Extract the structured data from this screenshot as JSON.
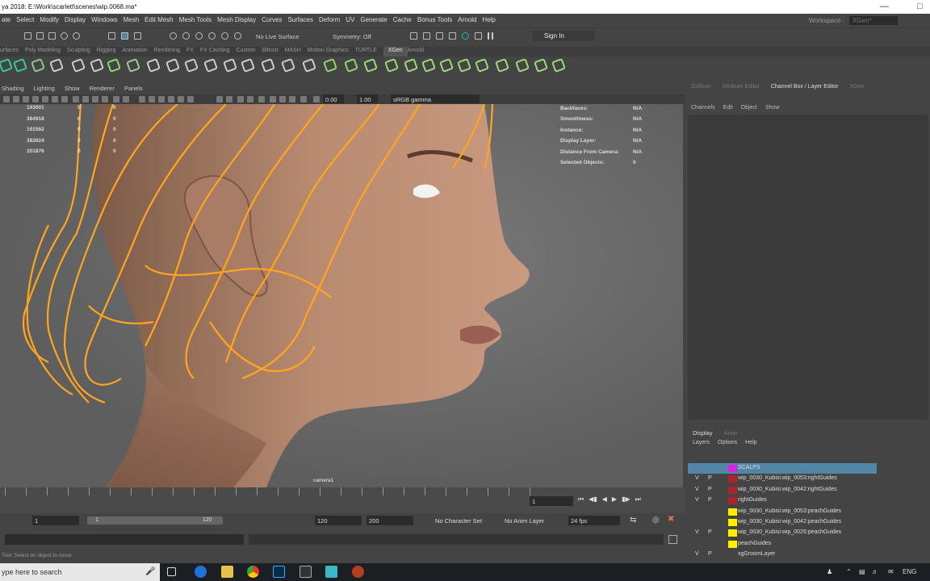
{
  "window": {
    "title": "ya 2018: E:\\Work\\scarlett\\scenes\\wip.0068.ma*"
  },
  "menubar": [
    "ate",
    "Select",
    "Modify",
    "Display",
    "Windows",
    "Mesh",
    "Edit Mesh",
    "Mesh Tools",
    "Mesh Display",
    "Curves",
    "Surfaces",
    "Deform",
    "UV",
    "Generate",
    "Cache",
    "Bonus Tools",
    "Arnold",
    "Help"
  ],
  "workspace": {
    "label": "Workspace :",
    "value": "XGen*"
  },
  "statusline": {
    "live_surface": "No Live Surface",
    "symmetry": "Symmetry: Off",
    "sign_in": "Sign In"
  },
  "shelf_tabs": [
    "urfaces",
    "Poly Modeling",
    "Sculpting",
    "Rigging",
    "Animation",
    "Rendering",
    "FX",
    "FX Caching",
    "Custom",
    "Bifrost",
    "MASH",
    "Motion Graphics",
    "TURTLE",
    "XGen",
    "Arnold"
  ],
  "shelf_active": "XGen",
  "viewport": {
    "menus": [
      "Shading",
      "Lighting",
      "Show",
      "Renderer",
      "Panels"
    ],
    "near_value": "0.00",
    "far_value": "1.00",
    "color_space": "sRGB gamma",
    "camera_label": "camera1",
    "stats_left": [
      "193001",
      "384918",
      "191562",
      "383924",
      "201876"
    ],
    "stats_zero": [
      "0",
      "0",
      "0",
      "0",
      "0"
    ],
    "hud": [
      {
        "k": "Backfaces:",
        "v": "N/A"
      },
      {
        "k": "Smoothness:",
        "v": "N/A"
      },
      {
        "k": "Instance:",
        "v": "N/A"
      },
      {
        "k": "Display Layer:",
        "v": "N/A"
      },
      {
        "k": "Distance From Camera:",
        "v": "N/A"
      },
      {
        "k": "Selected Objects:",
        "v": "0"
      }
    ]
  },
  "right_tabs": [
    "Outliner",
    "Attribute Editor",
    "Channel Box / Layer Editor",
    "XGen"
  ],
  "right_active": "Channel Box / Layer Editor",
  "channel_menu": [
    "Channels",
    "Edit",
    "Object",
    "Show"
  ],
  "layer_tabs": [
    "Display",
    "Anim"
  ],
  "layer_menu": [
    "Layers",
    "Options",
    "Help"
  ],
  "layers": [
    {
      "v": "",
      "p": "",
      "color": "#e020e0",
      "name": "SCALPS",
      "selected": true
    },
    {
      "v": "V",
      "p": "P",
      "color": "#b0202e",
      "name": "wip_0030_Kubisi:wip_0053:rightGuides",
      "selected": false
    },
    {
      "v": "V",
      "p": "P",
      "color": "#b0202e",
      "name": "wip_0030_Kubisi:wip_0042:rightGuides",
      "selected": false
    },
    {
      "v": "V",
      "p": "P",
      "color": "#b0202e",
      "name": "rightGuides",
      "selected": false
    },
    {
      "v": "",
      "p": "",
      "color": "#ffee00",
      "name": "wip_0030_Kubisi:wip_0053:peachGuides",
      "selected": false
    },
    {
      "v": "",
      "p": "",
      "color": "#ffee00",
      "name": "wip_0030_Kubisi:wip_0042:peachGuides",
      "selected": false
    },
    {
      "v": "V",
      "p": "P",
      "color": "#ffee00",
      "name": "wip_0030_Kubisi:wip_0026:peachGuides",
      "selected": false
    },
    {
      "v": "",
      "p": "",
      "color": "#ffee00",
      "name": "peachGuides",
      "selected": false
    },
    {
      "v": "V",
      "p": "P",
      "color": "",
      "name": "xgGroomLayer",
      "selected": false
    }
  ],
  "timeline": {
    "current_frame": "1"
  },
  "range": {
    "start": "1",
    "slider_start": "1",
    "slider_end": "120",
    "end": "120",
    "anim_end": "200",
    "character_set": "No Character Set",
    "anim_layer": "No Anim Layer",
    "fps": "24 fps"
  },
  "helpline": "Tool: Select an object to move",
  "taskbar": {
    "search_placeholder": "ype here to search",
    "lang": "ENG"
  },
  "colors": {
    "guides": "#ffa51e",
    "accent": "#5285a6"
  }
}
